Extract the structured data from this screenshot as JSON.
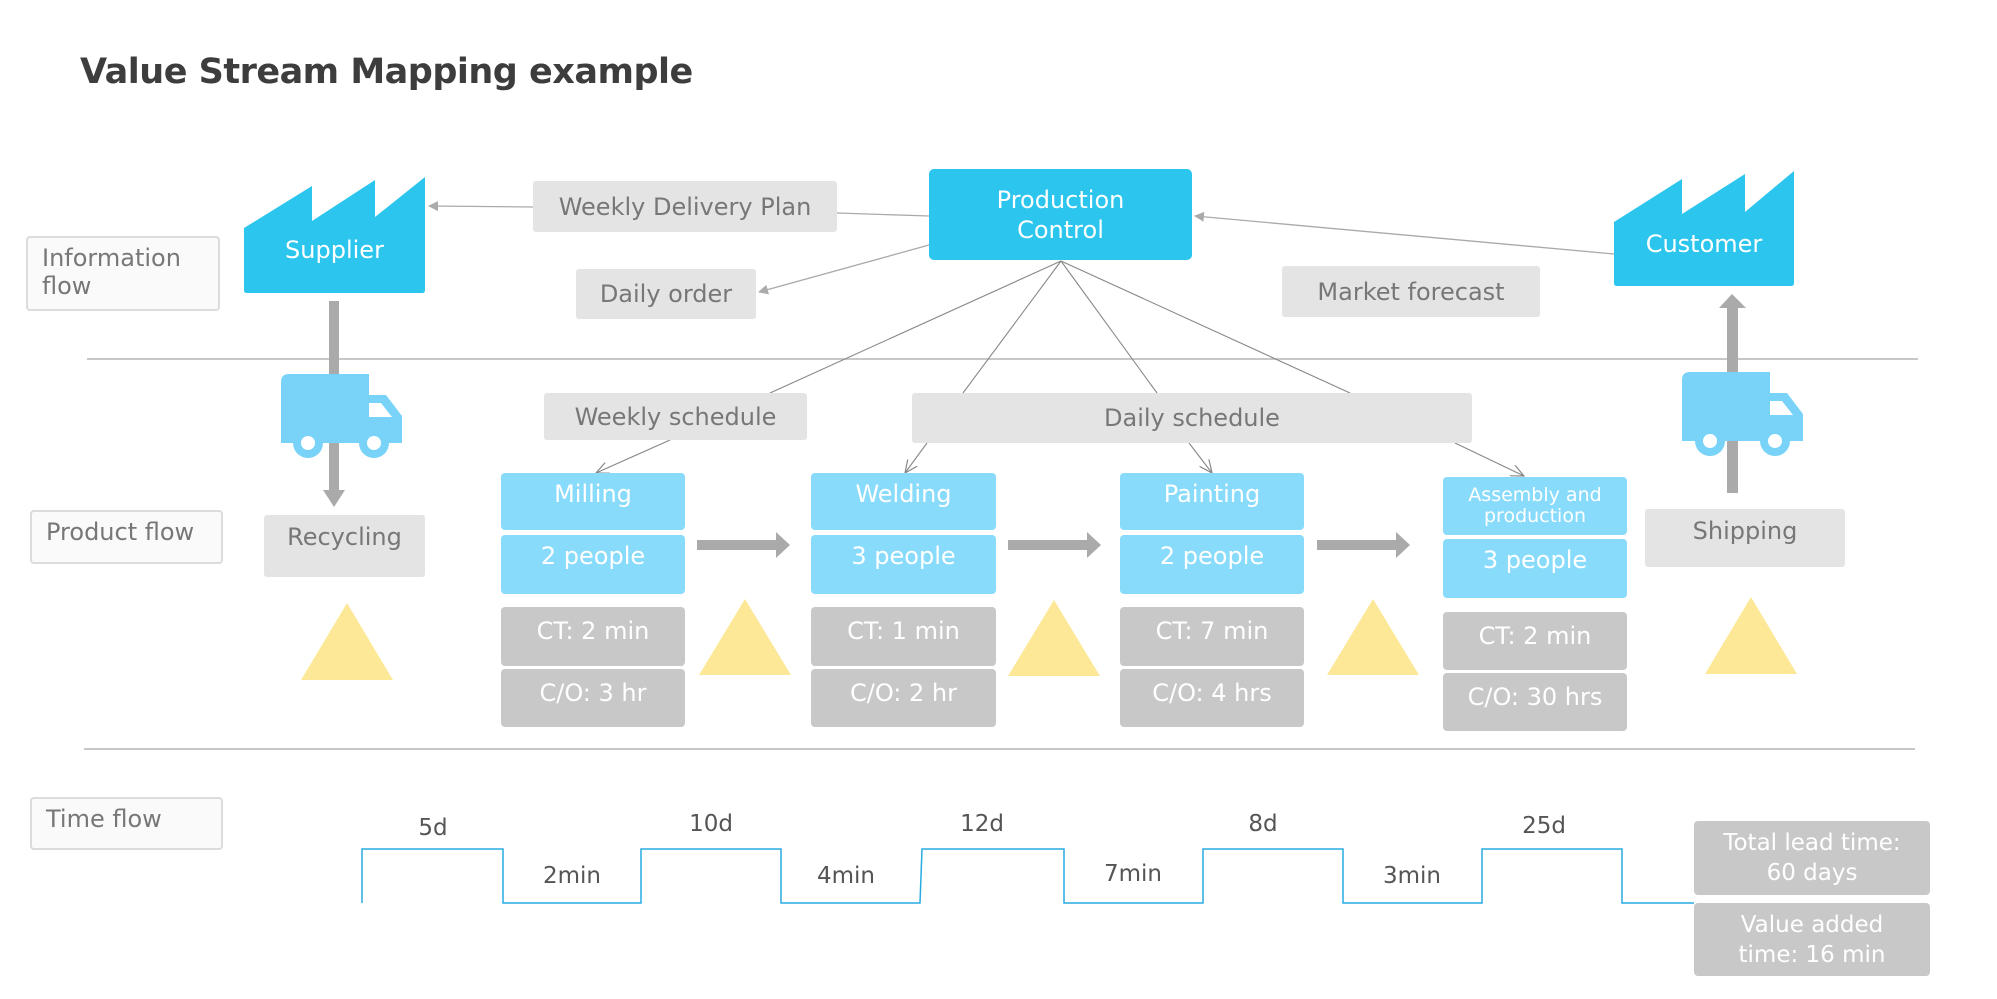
{
  "title": "Value Stream Mapping example",
  "lanes": {
    "information": "Information flow",
    "product": "Product flow",
    "time": "Time flow"
  },
  "information_flow": {
    "supplier": "Supplier",
    "customer": "Customer",
    "production_control": "Production Control",
    "weekly_delivery_plan": "Weekly Delivery Plan",
    "daily_order": "Daily order",
    "market_forecast": "Market forecast"
  },
  "schedules": {
    "weekly": "Weekly schedule",
    "daily": "Daily schedule"
  },
  "product_flow": {
    "recycling": "Recycling",
    "shipping": "Shipping",
    "processes": [
      {
        "name": "Milling",
        "people": "2 people",
        "ct": "CT: 2 min",
        "co": "C/O: 3 hr"
      },
      {
        "name": "Welding",
        "people": "3 people",
        "ct": "CT: 1 min",
        "co": "C/O: 2 hr"
      },
      {
        "name": "Painting",
        "people": "2 people",
        "ct": "CT: 7 min",
        "co": "C/O: 4 hrs"
      },
      {
        "name": "Assembly and production",
        "people": "3 people",
        "ct": "CT: 2 min",
        "co": "C/O: 30 hrs"
      }
    ]
  },
  "time_flow": {
    "waits": [
      "5d",
      "10d",
      "12d",
      "8d",
      "25d"
    ],
    "process_times": [
      "2min",
      "4min",
      "7min",
      "3min"
    ],
    "total_lead_time": "Total lead time: 60 days",
    "value_added_time": "Value added time: 16 min"
  },
  "colors": {
    "factory": "#2bc5ee",
    "process": "#89dbfc",
    "truck": "#79d3f8",
    "metric": "#c8c8c8",
    "tag": "#e4e4e4",
    "inventory": "#fce897",
    "timeline": "#29abe2"
  }
}
